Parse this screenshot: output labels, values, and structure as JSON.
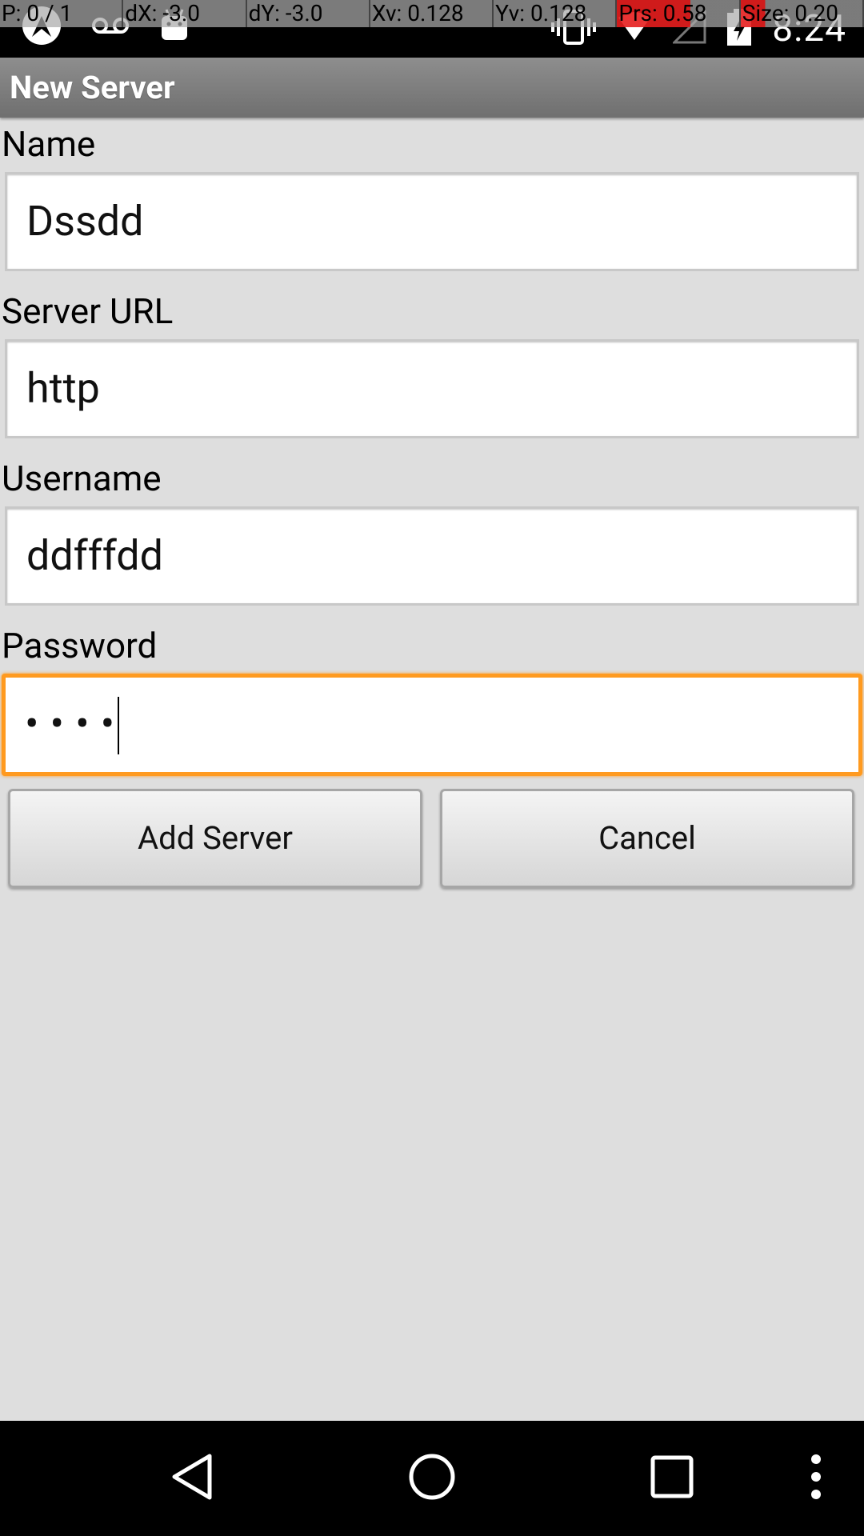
{
  "status_bar": {
    "time": "8:24",
    "left_icons": [
      "app-notification-icon",
      "voicemail-icon",
      "android-icon"
    ],
    "right_icons": [
      "vibrate-icon",
      "wifi-icon",
      "no-signal-icon",
      "battery-charging-icon"
    ]
  },
  "pointer_overlay": {
    "p": "P: 0 / 1",
    "dx": "dX: -3.0",
    "dy": "dY: -3.0",
    "xv": "Xv: 0.128",
    "yv": "Yv: 0.128",
    "prs": "Prs: 0.58",
    "size": "Size: 0.20"
  },
  "title_bar": {
    "title": "New Server"
  },
  "form": {
    "name": {
      "label": "Name",
      "value": "Dssdd"
    },
    "server_url": {
      "label": "Server URL",
      "value": "http"
    },
    "username": {
      "label": "Username",
      "value": "ddfffdd"
    },
    "password": {
      "label": "Password",
      "value": "••••"
    }
  },
  "buttons": {
    "add_server": "Add Server",
    "cancel": "Cancel"
  },
  "nav_bar": {
    "icons": [
      "back-icon",
      "home-icon",
      "recents-icon",
      "menu-icon"
    ]
  },
  "colors": {
    "background": "#dedede",
    "focus_border": "#ff9a1f",
    "title_bar": "#7f7f7f"
  }
}
